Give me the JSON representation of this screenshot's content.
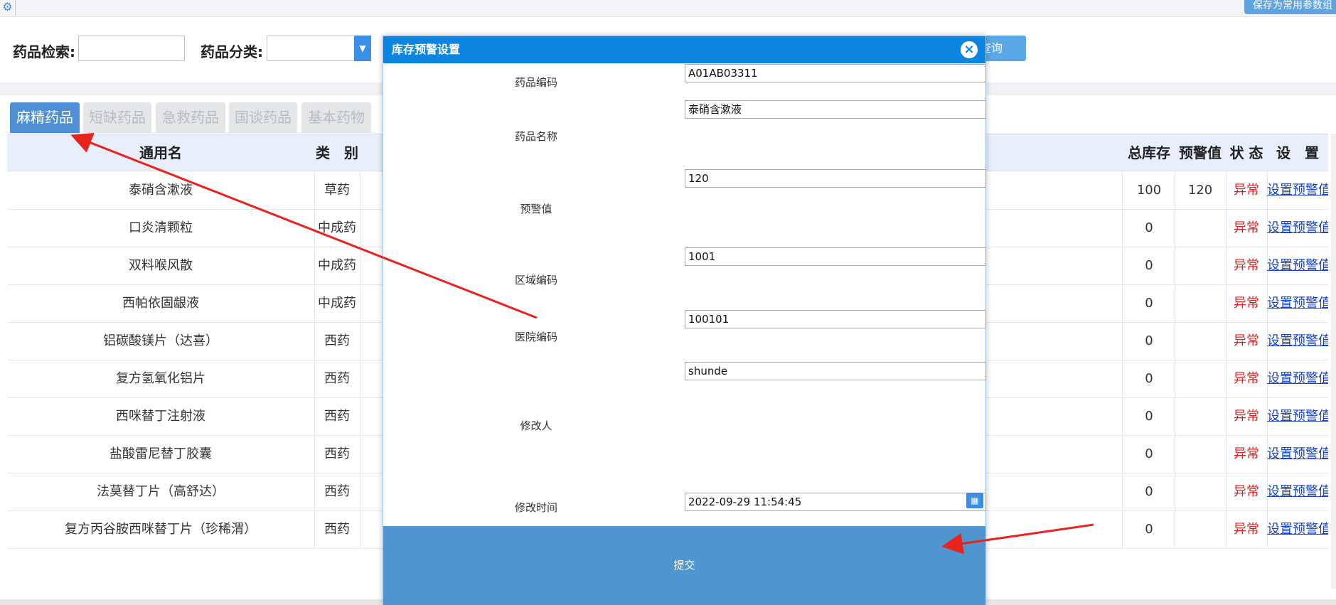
{
  "topbar": {
    "save_common_label": "保存为常用参数组"
  },
  "search": {
    "keyword_label": "药品检索:",
    "keyword_value": "",
    "category_label": "药品分类:",
    "category_value": "",
    "query_label": "查询"
  },
  "tabs": [
    {
      "label": "麻精药品",
      "active": true
    },
    {
      "label": "短缺药品",
      "active": false
    },
    {
      "label": "急救药品",
      "active": false
    },
    {
      "label": "国谈药品",
      "active": false
    },
    {
      "label": "基本药物",
      "active": false
    }
  ],
  "table": {
    "headers": {
      "name": "通用名",
      "category": "类　别",
      "total_stock": "总库存",
      "warn_value": "预警值",
      "status": "状 态",
      "settings": "设　置"
    },
    "rows": [
      {
        "name": "泰硝含漱液",
        "category": "草药",
        "total_stock": "100",
        "warn_value": "120",
        "status": "异常",
        "action": "设置预警值"
      },
      {
        "name": "口炎清颗粒",
        "category": "中成药",
        "total_stock": "0",
        "warn_value": "",
        "status": "异常",
        "action": "设置预警值"
      },
      {
        "name": "双料喉风散",
        "category": "中成药",
        "total_stock": "0",
        "warn_value": "",
        "status": "异常",
        "action": "设置预警值"
      },
      {
        "name": "西帕依固龈液",
        "category": "中成药",
        "total_stock": "0",
        "warn_value": "",
        "status": "异常",
        "action": "设置预警值"
      },
      {
        "name": "铝碳酸镁片（达喜）",
        "category": "西药",
        "total_stock": "0",
        "warn_value": "",
        "status": "异常",
        "action": "设置预警值"
      },
      {
        "name": "复方氢氧化铝片",
        "category": "西药",
        "total_stock": "0",
        "warn_value": "",
        "status": "异常",
        "action": "设置预警值"
      },
      {
        "name": "西咪替丁注射液",
        "category": "西药",
        "total_stock": "0",
        "warn_value": "",
        "status": "异常",
        "action": "设置预警值"
      },
      {
        "name": "盐酸雷尼替丁胶囊",
        "category": "西药",
        "total_stock": "0",
        "warn_value": "",
        "status": "异常",
        "action": "设置预警值"
      },
      {
        "name": "法莫替丁片（高舒达）",
        "category": "西药",
        "total_stock": "0",
        "warn_value": "",
        "status": "异常",
        "action": "设置预警值"
      },
      {
        "name": "复方丙谷胺西咪替丁片（珍稀渭）",
        "category": "西药",
        "total_stock": "0",
        "warn_value": "",
        "status": "异常",
        "action": "设置预警值"
      }
    ]
  },
  "modal": {
    "title": "库存预警设置",
    "fields": {
      "drug_code": {
        "label": "药品编码",
        "value": "A01AB03311"
      },
      "drug_name": {
        "label": "药品名称",
        "value": "泰硝含漱液"
      },
      "warn_value": {
        "label": "预警值",
        "value": "120"
      },
      "region_code": {
        "label": "区域编码",
        "value": "1001"
      },
      "hospital_code": {
        "label": "医院编码",
        "value": "100101"
      },
      "modifier": {
        "label": "修改人",
        "value": "shunde"
      },
      "modify_time": {
        "label": "修改时间",
        "value": "2022-09-29 11:54:45"
      }
    },
    "submit_label": "提交"
  },
  "colors": {
    "accent": "#0b85e0",
    "status_error": "#e02020",
    "link": "#1a44c8",
    "annotation_arrow": "#e8231e"
  }
}
